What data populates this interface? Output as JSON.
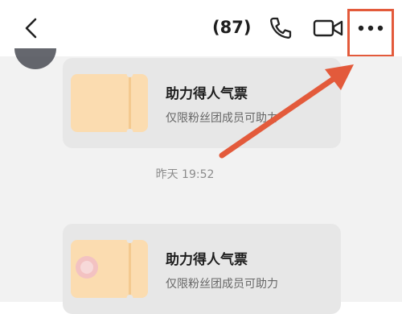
{
  "header": {
    "count_label": "(87)"
  },
  "icons": {
    "back": "back-chevron-icon",
    "call": "phone-icon",
    "video": "video-camera-icon",
    "more": "more-dots-icon"
  },
  "messages": [
    {
      "title": "助力得人气票",
      "subtitle": "仅限粉丝团成员可助力"
    },
    {
      "title": "助力得人气票",
      "subtitle": "仅限粉丝团成员可助力"
    }
  ],
  "timestamp": "昨天 19:52",
  "colors": {
    "highlight": "#e35a3b",
    "chat_background": "#f2f2f2",
    "card_background": "#e7e7e7",
    "ticket": "#fbdcb0"
  }
}
